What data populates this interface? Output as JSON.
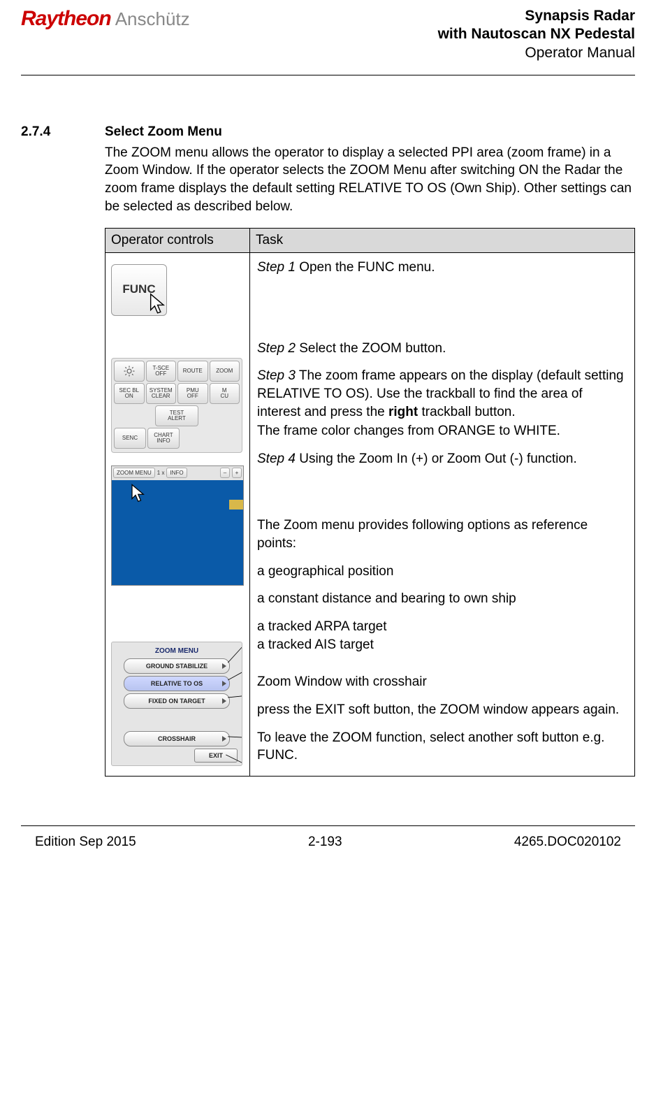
{
  "header": {
    "brand1": "Raytheon",
    "brand2": "Anschütz",
    "title1": "Synapsis Radar",
    "title2": "with Nautoscan NX Pedestal",
    "title3": "Operator Manual"
  },
  "section": {
    "number": "2.7.4",
    "title": "Select Zoom Menu",
    "intro": "The ZOOM menu allows the operator to display a selected PPI area (zoom frame) in a Zoom Window. If the operator selects the ZOOM Menu after switching ON the Radar the zoom frame displays the default setting RELATIVE TO OS (Own Ship). Other settings can be selected as described below."
  },
  "table": {
    "col1": "Operator controls",
    "col2": "Task"
  },
  "controls": {
    "func": "FUNC",
    "grid": {
      "r1": [
        "",
        "T-SCE\nOFF",
        "ROUTE",
        "ZOOM"
      ],
      "r2": [
        "SEC BL\nON",
        "SYSTEM\nCLEAR",
        "PMU\nOFF",
        "M\nCU"
      ],
      "r3_test": "TEST\nALERT",
      "r4": [
        "SENC",
        "CHART\nINFO"
      ]
    },
    "zoomwin": {
      "menu": "ZOOM MENU",
      "scale": "1 x",
      "info": "INFO",
      "minus": "–",
      "plus": "+"
    },
    "zoommenu": {
      "title": "ZOOM MENU",
      "b1": "GROUND STABILIZE",
      "b2": "RELATIVE TO OS",
      "b3": "FIXED ON TARGET",
      "b4": "CROSSHAIR",
      "exit": "EXIT"
    }
  },
  "task": {
    "s1_label": "Step 1",
    "s1_text": " Open the FUNC menu.",
    "s2_label": "Step 2",
    "s2_text": " Select the ZOOM button.",
    "s3_label": "Step 3",
    "s3_pre": " The zoom frame appears on the display (default setting RELATIVE TO OS). Use the trackball to find the area of interest and press the ",
    "s3_bold": "right",
    "s3_post": " trackball button.",
    "s3_line2": "The frame color changes from ORANGE to WHITE.",
    "s4_label": "Step 4",
    "s4_text": " Using the Zoom In (+) or Zoom Out (-) function.",
    "opts_intro": "The Zoom menu provides following options as reference points:",
    "opt1": "a geographical position",
    "opt2": "a constant distance and bearing to own ship",
    "opt3": "a tracked ARPA target",
    "opt4": "a tracked AIS target",
    "opt5": "Zoom Window with crosshair",
    "exit_text": "press the EXIT soft button, the ZOOM window appears again.",
    "leave": "To leave the ZOOM function, select another soft button e.g. FUNC."
  },
  "footer": {
    "edition": "Edition Sep 2015",
    "page": "2-193",
    "docno": "4265.DOC020102"
  }
}
